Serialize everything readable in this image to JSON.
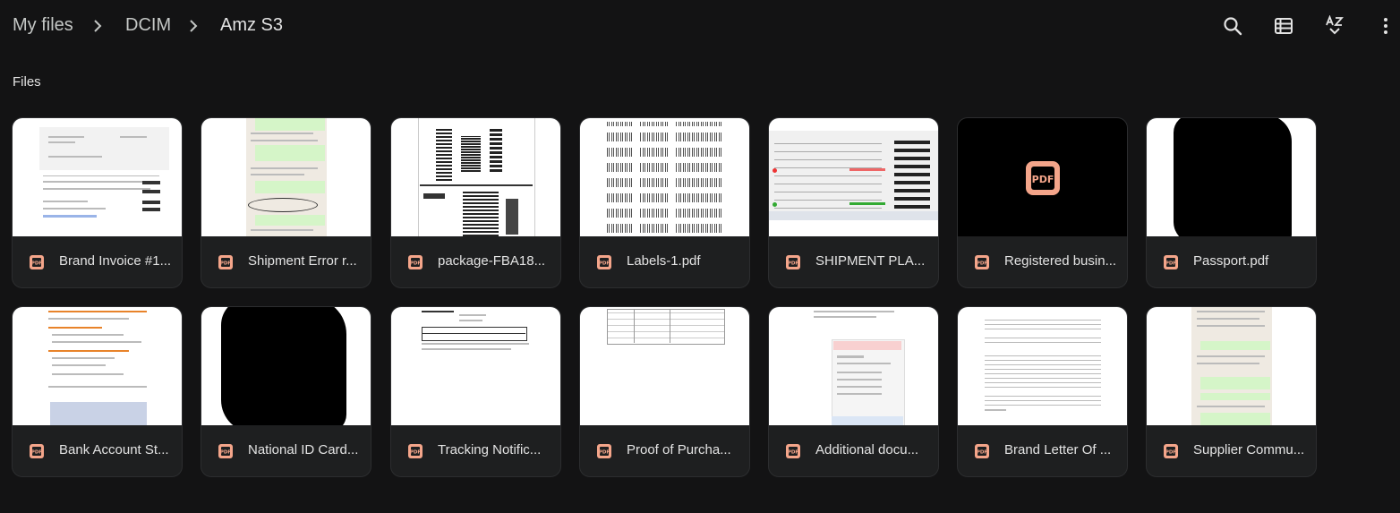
{
  "breadcrumb": [
    {
      "label": "My files"
    },
    {
      "label": "DCIM"
    },
    {
      "label": "Amz S3"
    }
  ],
  "toolbar": {
    "search_icon": "search-icon",
    "view_icon": "list-view-icon",
    "sort_icon": "sort-az-icon",
    "more_icon": "more-vert-icon"
  },
  "section": {
    "title": "Files"
  },
  "files": [
    {
      "name": "Brand Invoice #1...",
      "icon": "pdf-icon"
    },
    {
      "name": "Shipment Error r...",
      "icon": "pdf-icon"
    },
    {
      "name": "package-FBA18...",
      "icon": "pdf-icon"
    },
    {
      "name": "Labels-1.pdf",
      "icon": "pdf-icon"
    },
    {
      "name": "SHIPMENT PLA...",
      "icon": "pdf-icon"
    },
    {
      "name": "Registered busin...",
      "icon": "pdf-icon"
    },
    {
      "name": "Passport.pdf",
      "icon": "pdf-icon"
    },
    {
      "name": "Bank Account St...",
      "icon": "pdf-icon"
    },
    {
      "name": "National ID Card...",
      "icon": "pdf-icon"
    },
    {
      "name": "Tracking Notific...",
      "icon": "pdf-icon"
    },
    {
      "name": "Proof of Purcha...",
      "icon": "pdf-icon"
    },
    {
      "name": "Additional docu...",
      "icon": "pdf-icon"
    },
    {
      "name": "Brand Letter Of ...",
      "icon": "pdf-icon"
    },
    {
      "name": "Supplier Commu...",
      "icon": "pdf-icon"
    }
  ],
  "colors": {
    "background": "#131314",
    "card": "#1e1f20",
    "pdf_accent": "#f4a58a"
  }
}
